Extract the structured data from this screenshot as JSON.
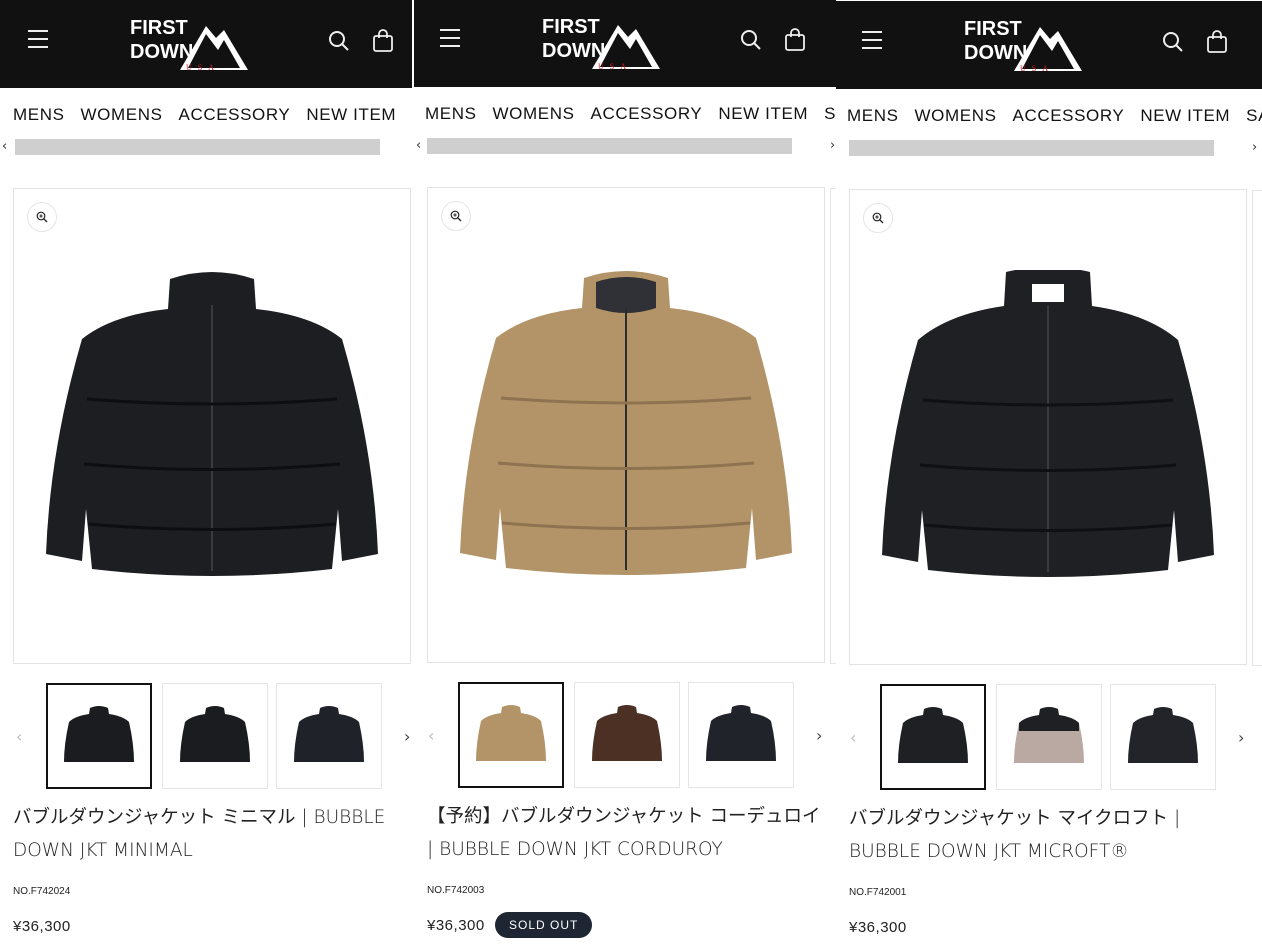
{
  "brand": {
    "name_line1": "FIRST",
    "name_line2": "DOWN",
    "sub": "USA"
  },
  "nav": {
    "items": [
      "MENS",
      "WOMENS",
      "ACCESSORY",
      "NEW ITEM",
      "SALE"
    ]
  },
  "products": [
    {
      "title": "バブルダウンジャケット ミニマル | BUBBLE DOWN JKT MINIMAL",
      "sku": "NO.F742024",
      "price": "¥36,300",
      "badge": "",
      "color": "#1d1e22",
      "thumbs": [
        "#1b1c20",
        "#1b1c20",
        "#20222a"
      ]
    },
    {
      "title": "【予約】バブルダウンジャケット コーデュロイ | BUBBLE DOWN JKT CORDUROY",
      "sku": "NO.F742003",
      "price": "¥36,300",
      "badge": "SOLD OUT",
      "color": "#b39468",
      "thumbs": [
        "#b39468",
        "#4b3023",
        "#20232a"
      ]
    },
    {
      "title": "バブルダウンジャケット マイクロフト | BUBBLE DOWN JKT MICROFT®",
      "sku": "NO.F742001",
      "price": "¥36,300",
      "badge": "",
      "color": "#1f2023",
      "thumbs": [
        "#1f2023",
        "#b9a9a2",
        "#22242a"
      ]
    }
  ]
}
